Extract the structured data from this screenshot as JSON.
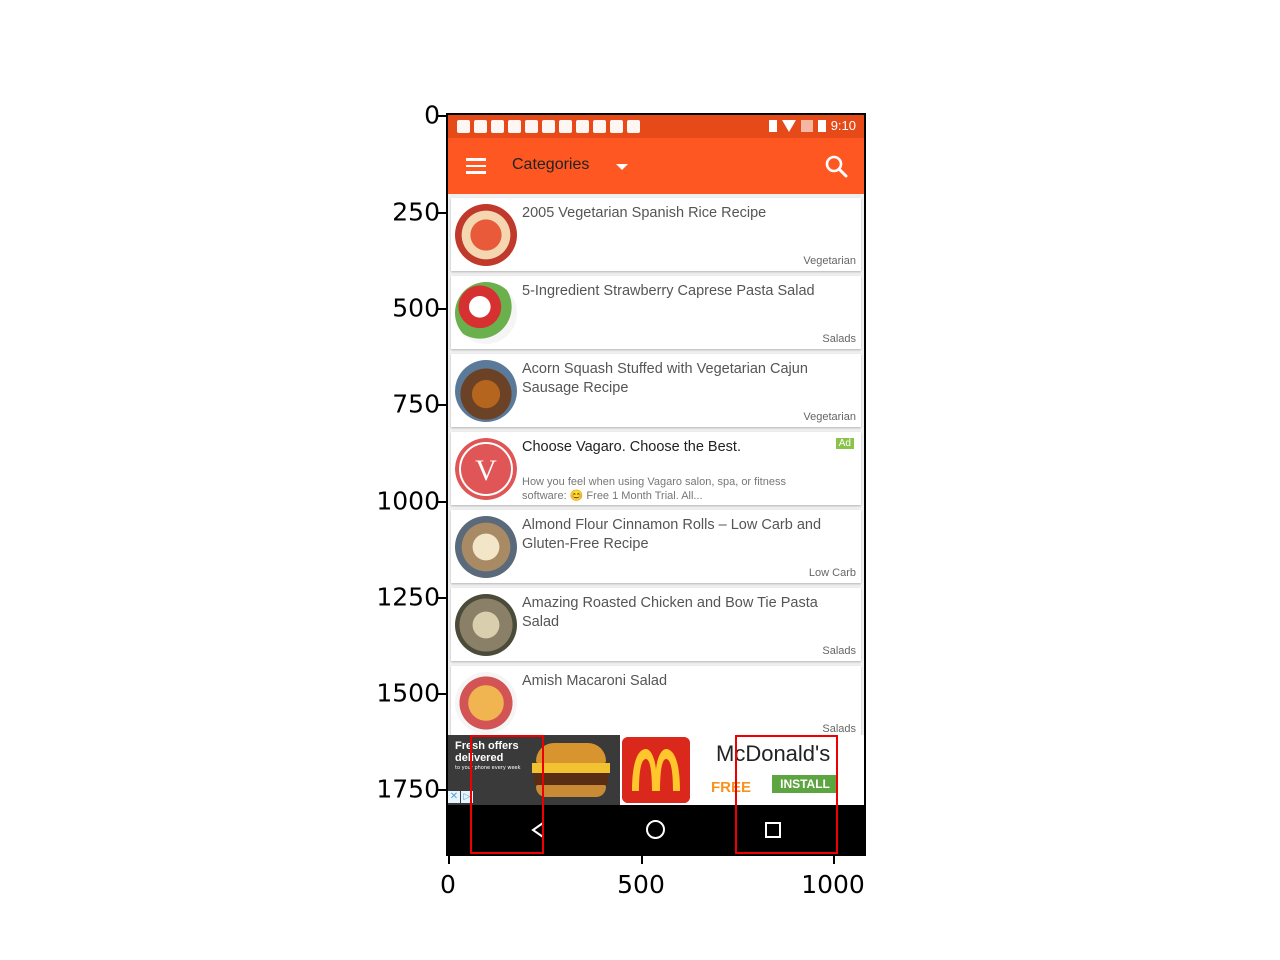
{
  "axes": {
    "y_ticks": [
      "0",
      "250",
      "500",
      "750",
      "1000",
      "1250",
      "1500",
      "1750"
    ],
    "x_ticks": [
      "0",
      "500",
      "1000"
    ]
  },
  "status_bar": {
    "time": "9:10"
  },
  "app_bar": {
    "title": "Categories"
  },
  "recipes": [
    {
      "title": "2005 Vegetarian Spanish Rice Recipe",
      "category": "Vegetarian",
      "thumb_color": "#c0392b"
    },
    {
      "title": "5-Ingredient Strawberry Caprese Pasta Salad",
      "category": "Salads",
      "thumb_color": "#d35454"
    },
    {
      "title": "Acorn Squash Stuffed with Vegetarian Cajun Sausage Recipe",
      "category": "Vegetarian",
      "thumb_color": "#7a5a2e"
    },
    {
      "title": "Almond Flour Cinnamon Rolls – Low Carb and Gluten-Free Recipe",
      "category": "Low Carb",
      "thumb_color": "#a88a64"
    },
    {
      "title": "Amazing Roasted Chicken and Bow Tie Pasta Salad",
      "category": "Salads",
      "thumb_color": "#8a8068"
    },
    {
      "title": "Amish Macaroni Salad",
      "category": "Salads",
      "thumb_color": "#e0a040"
    }
  ],
  "ad_card": {
    "title": "Choose Vagaro. Choose the Best.",
    "badge": "Ad",
    "description": "How you feel when using Vagaro salon, spa, or fitness software: 😊 Free 1 Month Trial. All...",
    "logo_letter": "V"
  },
  "banner_ad": {
    "headline_line1": "Fresh offers",
    "headline_line2": "delivered",
    "subline": "to your phone every week",
    "brand": "McDonald's",
    "price_label": "FREE",
    "install_label": "INSTALL",
    "close_glyph": "✕",
    "info_glyph": "▷"
  },
  "colors": {
    "app_bar": "#ff5722",
    "status_bar": "#e64a19",
    "install_green": "#5da541",
    "mcdonalds_red": "#da291c"
  }
}
